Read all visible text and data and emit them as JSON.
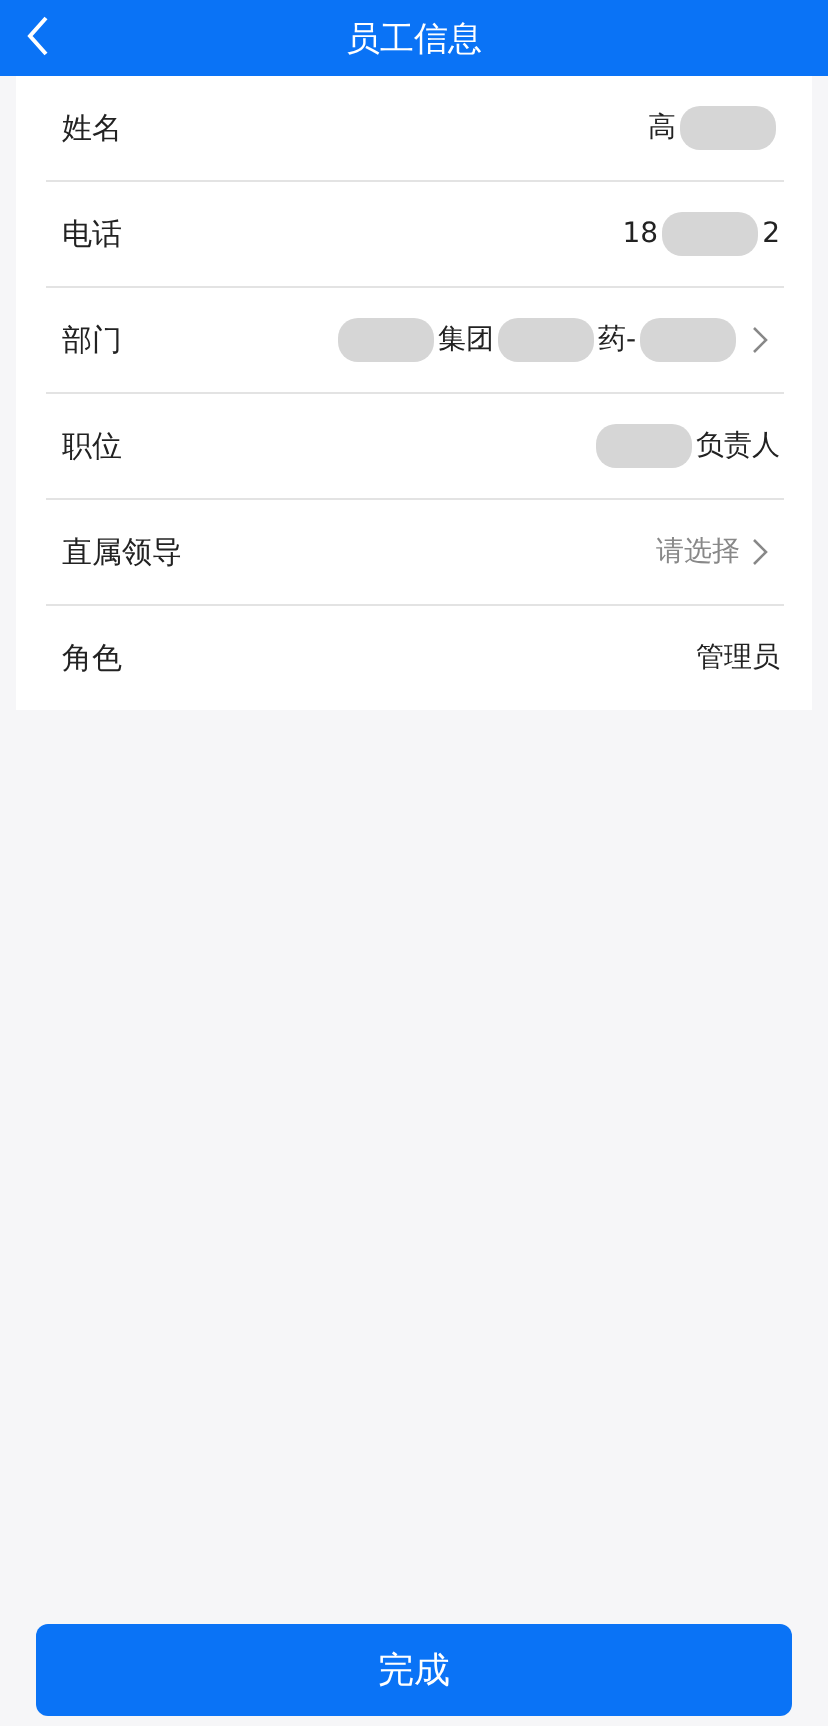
{
  "header": {
    "title": "员工信息"
  },
  "rows": [
    {
      "label": "姓名",
      "kind": "value",
      "parts": [
        {
          "kind": "text",
          "text": "高"
        },
        {
          "kind": "redacted"
        }
      ]
    },
    {
      "label": "电话",
      "kind": "value",
      "parts": [
        {
          "kind": "text",
          "text": "18"
        },
        {
          "kind": "redacted"
        },
        {
          "kind": "text",
          "text": "2"
        }
      ]
    },
    {
      "label": "部门",
      "kind": "picker",
      "parts": [
        {
          "kind": "redacted"
        },
        {
          "kind": "text",
          "text": "集团"
        },
        {
          "kind": "redacted"
        },
        {
          "kind": "text",
          "text": "药-"
        },
        {
          "kind": "redacted"
        }
      ]
    },
    {
      "label": "职位",
      "kind": "value",
      "parts": [
        {
          "kind": "redacted"
        },
        {
          "kind": "text",
          "text": "负责人"
        }
      ]
    },
    {
      "label": "直属领导",
      "kind": "picker",
      "placeholder": "请选择"
    },
    {
      "label": "角色",
      "kind": "value",
      "parts": [
        {
          "kind": "text",
          "text": "管理员"
        }
      ]
    }
  ],
  "submit": "完成"
}
